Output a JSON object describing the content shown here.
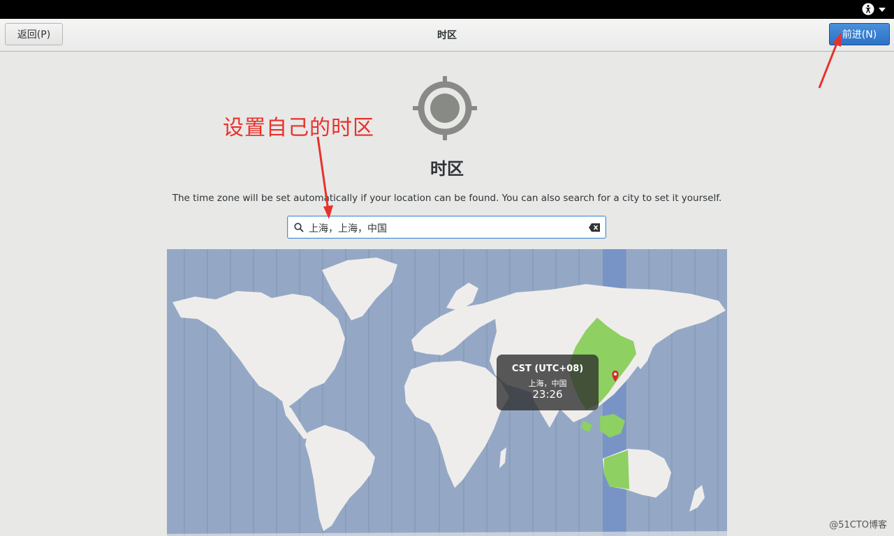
{
  "header": {
    "back_label": "返回(P)",
    "title": "时区",
    "next_label": "前进(N)"
  },
  "page": {
    "title": "时区",
    "description": "The time zone will be set automatically if your location can be found. You can also search for a city to set it yourself."
  },
  "search": {
    "value": "上海，上海，中国"
  },
  "map": {
    "tooltip": {
      "zone": "CST (UTC+08)",
      "city": "上海，中国",
      "time": "23:26"
    }
  },
  "annotation": {
    "text": "设置自己的时区",
    "color": "#e8312a"
  },
  "watermark": "@51CTO博客",
  "colors": {
    "accent": "#4a90d9",
    "map_ocean": "#94a8c6",
    "map_land": "#efedeb",
    "selected_zone": "#7fb7e0",
    "selected_land": "#8ed062"
  }
}
